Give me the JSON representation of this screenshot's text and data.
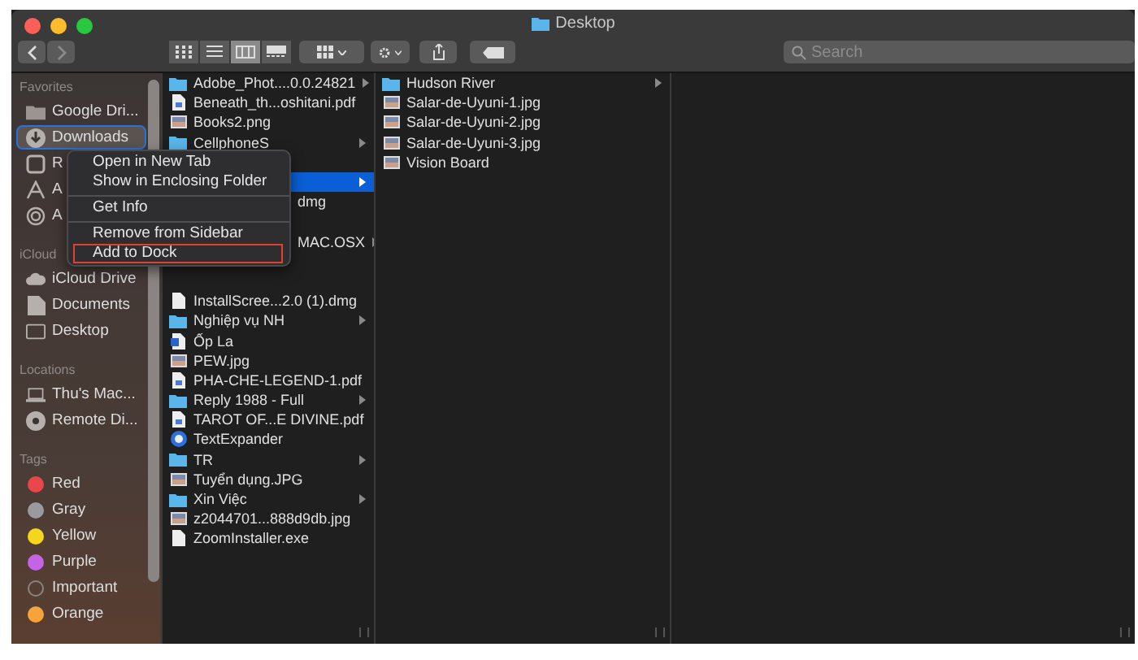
{
  "window": {
    "title": "Desktop"
  },
  "toolbar": {
    "view_modes": [
      {
        "kind": "icons",
        "selected": false
      },
      {
        "kind": "list",
        "selected": false
      },
      {
        "kind": "columns",
        "selected": true
      },
      {
        "kind": "gallery",
        "selected": false
      }
    ]
  },
  "search": {
    "placeholder": "Search"
  },
  "sidebar": {
    "sections": [
      {
        "heading": "Favorites",
        "items": [
          {
            "label": "Google Dri...",
            "kind": "folder",
            "selected": false
          },
          {
            "label": "Downloads",
            "kind": "download",
            "selected": true
          },
          {
            "label": "R",
            "kind": "recents",
            "selected": false
          },
          {
            "label": "A",
            "kind": "apps",
            "selected": false
          },
          {
            "label": "A",
            "kind": "airdrop",
            "selected": false
          }
        ]
      },
      {
        "heading": "iCloud",
        "items": [
          {
            "label": "iCloud Drive",
            "kind": "cloud",
            "selected": false
          },
          {
            "label": "Documents",
            "kind": "doc",
            "selected": false
          },
          {
            "label": "Desktop",
            "kind": "desktop",
            "selected": false
          }
        ]
      },
      {
        "heading": "Locations",
        "items": [
          {
            "label": "Thu's Mac...",
            "kind": "laptop",
            "selected": false
          },
          {
            "label": "Remote Di...",
            "kind": "disc",
            "selected": false
          }
        ]
      },
      {
        "heading": "Tags",
        "items": [
          {
            "label": "Red",
            "kind": "tag",
            "color": "#e9474a",
            "selected": false
          },
          {
            "label": "Gray",
            "kind": "tag",
            "color": "#9a9a9e",
            "selected": false
          },
          {
            "label": "Yellow",
            "kind": "tag",
            "color": "#f4d71c",
            "selected": false
          },
          {
            "label": "Purple",
            "kind": "tag",
            "color": "#c463e4",
            "selected": false
          },
          {
            "label": "Important",
            "kind": "ring",
            "selected": false
          },
          {
            "label": "Orange",
            "kind": "tag",
            "color": "#f4a43a",
            "selected": false
          }
        ]
      }
    ]
  },
  "columns": [
    {
      "rows": [
        {
          "name": "Adobe_Phot....0.0.24821",
          "kind": "folder",
          "selected": false,
          "expandable": true
        },
        {
          "name": "Beneath_th...oshitani.pdf",
          "kind": "pdf",
          "selected": false,
          "expandable": false
        },
        {
          "name": "Books2.png",
          "kind": "image",
          "selected": false,
          "expandable": false
        },
        {
          "name": "CellphoneS",
          "kind": "folder",
          "selected": false,
          "expandable": true
        },
        {
          "kind": "partial",
          "selected": false
        },
        {
          "kind": "partial",
          "selected": true,
          "expandable": true
        },
        {
          "name": "dmg",
          "kind": "partial",
          "selected": false,
          "expandable": false
        },
        {
          "kind": "partial",
          "selected": false
        },
        {
          "name": "MAC.OSX",
          "kind": "partial",
          "selected": false,
          "expandable": true
        },
        {
          "kind": "partial",
          "selected": false
        },
        {
          "kind": "partial",
          "selected": false
        },
        {
          "name": "InstallScree...2.0 (1).dmg",
          "kind": "doc",
          "selected": false,
          "expandable": false
        },
        {
          "name": "Nghiệp vụ NH",
          "kind": "folder",
          "selected": false,
          "expandable": true
        },
        {
          "name": "Ốp La",
          "kind": "word",
          "selected": false,
          "expandable": false
        },
        {
          "name": "PEW.jpg",
          "kind": "image",
          "selected": false,
          "expandable": false
        },
        {
          "name": "PHA-CHE-LEGEND-1.pdf",
          "kind": "pdf",
          "selected": false,
          "expandable": false
        },
        {
          "name": "Reply 1988 - Full",
          "kind": "folder",
          "selected": false,
          "expandable": true
        },
        {
          "name": "TAROT OF...E DIVINE.pdf",
          "kind": "pdf",
          "selected": false,
          "expandable": false
        },
        {
          "name": "TextExpander",
          "kind": "app",
          "selected": false,
          "expandable": false
        },
        {
          "name": "TR",
          "kind": "folder",
          "selected": false,
          "expandable": true
        },
        {
          "name": "Tuyển dụng.JPG",
          "kind": "image",
          "selected": false,
          "expandable": false
        },
        {
          "name": "Xin Việc",
          "kind": "folder",
          "selected": false,
          "expandable": true
        },
        {
          "name": "z2044701...888d9db.jpg",
          "kind": "image",
          "selected": false,
          "expandable": false
        },
        {
          "name": "ZoomInstaller.exe",
          "kind": "doc",
          "selected": false,
          "expandable": false
        }
      ]
    },
    {
      "rows": [
        {
          "name": "Hudson River",
          "kind": "folder",
          "selected": false,
          "expandable": true
        },
        {
          "name": "Salar-de-Uyuni-1.jpg",
          "kind": "image",
          "selected": false,
          "expandable": false
        },
        {
          "name": "Salar-de-Uyuni-2.jpg",
          "kind": "image",
          "selected": false,
          "expandable": false
        },
        {
          "name": "Salar-de-Uyuni-3.jpg",
          "kind": "image",
          "selected": false,
          "expandable": false
        },
        {
          "name": "Vision Board",
          "kind": "image",
          "selected": false,
          "expandable": false
        }
      ]
    }
  ],
  "context_menu": {
    "groups": [
      [
        {
          "label": "Open in New Tab",
          "highlighted": false
        },
        {
          "label": "Show in Enclosing Folder",
          "highlighted": false
        }
      ],
      [
        {
          "label": "Get Info",
          "highlighted": false
        }
      ],
      [
        {
          "label": "Remove from Sidebar",
          "highlighted": false
        },
        {
          "label": "Add to Dock",
          "highlighted": true
        }
      ]
    ]
  }
}
